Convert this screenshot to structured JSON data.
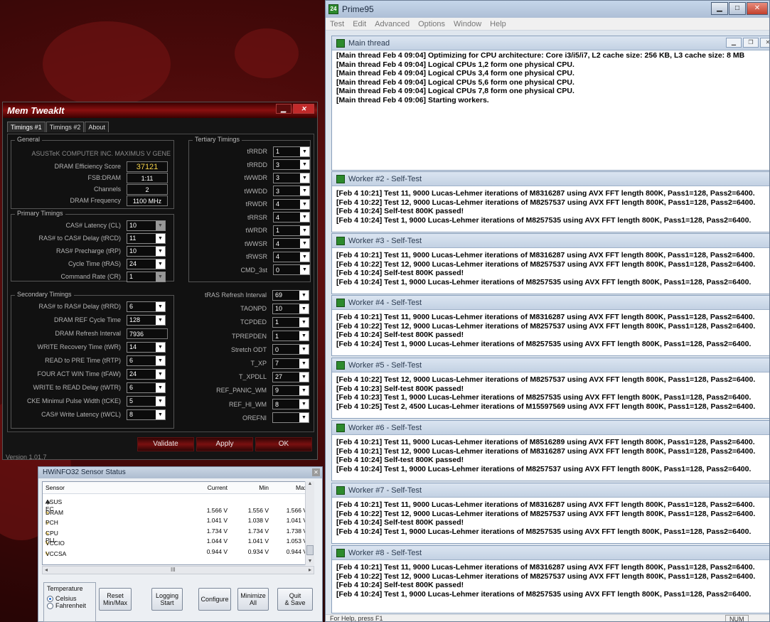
{
  "prime95": {
    "title": "Prime95",
    "menu": [
      "Test",
      "Edit",
      "Advanced",
      "Options",
      "Window",
      "Help"
    ],
    "main_thread": {
      "title": "Main thread",
      "lines": [
        "[Main thread Feb 4 09:04] Optimizing for CPU architecture: Core i3/i5/i7, L2 cache size: 256 KB, L3 cache size: 8 MB",
        "[Main thread Feb 4 09:04] Logical CPUs 1,2 form one physical CPU.",
        "[Main thread Feb 4 09:04] Logical CPUs 3,4 form one physical CPU.",
        "[Main thread Feb 4 09:04] Logical CPUs 5,6 form one physical CPU.",
        "[Main thread Feb 4 09:04] Logical CPUs 7,8 form one physical CPU.",
        "[Main thread Feb 4 09:06] Starting workers."
      ]
    },
    "workers": [
      {
        "title": "Worker #2 - Self-Test",
        "lines": [
          "[Feb 4 10:21] Test 11, 9000 Lucas-Lehmer iterations of M8316287 using AVX FFT length 800K, Pass1=128, Pass2=6400.",
          "[Feb 4 10:22] Test 12, 9000 Lucas-Lehmer iterations of M8257537 using AVX FFT length 800K, Pass1=128, Pass2=6400.",
          "[Feb 4 10:24] Self-test 800K passed!",
          "[Feb 4 10:24] Test 1, 9000 Lucas-Lehmer iterations of M8257535 using AVX FFT length 800K, Pass1=128, Pass2=6400."
        ]
      },
      {
        "title": "Worker #3 - Self-Test",
        "lines": [
          "[Feb 4 10:21] Test 11, 9000 Lucas-Lehmer iterations of M8316287 using AVX FFT length 800K, Pass1=128, Pass2=6400.",
          "[Feb 4 10:22] Test 12, 9000 Lucas-Lehmer iterations of M8257537 using AVX FFT length 800K, Pass1=128, Pass2=6400.",
          "[Feb 4 10:24] Self-test 800K passed!",
          "[Feb 4 10:24] Test 1, 9000 Lucas-Lehmer iterations of M8257535 using AVX FFT length 800K, Pass1=128, Pass2=6400."
        ]
      },
      {
        "title": "Worker #4 - Self-Test",
        "lines": [
          "[Feb 4 10:21] Test 11, 9000 Lucas-Lehmer iterations of M8316287 using AVX FFT length 800K, Pass1=128, Pass2=6400.",
          "[Feb 4 10:22] Test 12, 9000 Lucas-Lehmer iterations of M8257537 using AVX FFT length 800K, Pass1=128, Pass2=6400.",
          "[Feb 4 10:24] Self-test 800K passed!",
          "[Feb 4 10:24] Test 1, 9000 Lucas-Lehmer iterations of M8257535 using AVX FFT length 800K, Pass1=128, Pass2=6400."
        ]
      },
      {
        "title": "Worker #5 - Self-Test",
        "lines": [
          "[Feb 4 10:22] Test 12, 9000 Lucas-Lehmer iterations of M8257537 using AVX FFT length 800K, Pass1=128, Pass2=6400.",
          "[Feb 4 10:23] Self-test 800K passed!",
          "[Feb 4 10:23] Test 1, 9000 Lucas-Lehmer iterations of M8257535 using AVX FFT length 800K, Pass1=128, Pass2=6400.",
          "[Feb 4 10:25] Test 2, 4500 Lucas-Lehmer iterations of M15597569 using AVX FFT length 800K, Pass1=128, Pass2=6400."
        ]
      },
      {
        "title": "Worker #6 - Self-Test",
        "lines": [
          "[Feb 4 10:21] Test 11, 9000 Lucas-Lehmer iterations of M8516289 using AVX FFT length 800K, Pass1=128, Pass2=6400.",
          "[Feb 4 10:21] Test 12, 9000 Lucas-Lehmer iterations of M8316287 using AVX FFT length 800K, Pass1=128, Pass2=6400.",
          "[Feb 4 10:24] Self-test 800K passed!",
          "[Feb 4 10:24] Test 1, 9000 Lucas-Lehmer iterations of M8257537 using AVX FFT length 800K, Pass1=128, Pass2=6400."
        ]
      },
      {
        "title": "Worker #7 - Self-Test",
        "lines": [
          "[Feb 4 10:21] Test 11, 9000 Lucas-Lehmer iterations of M8316287 using AVX FFT length 800K, Pass1=128, Pass2=6400.",
          "[Feb 4 10:22] Test 12, 9000 Lucas-Lehmer iterations of M8257537 using AVX FFT length 800K, Pass1=128, Pass2=6400.",
          "[Feb 4 10:24] Self-test 800K passed!",
          "[Feb 4 10:24] Test 1, 9000 Lucas-Lehmer iterations of M8257535 using AVX FFT length 800K, Pass1=128, Pass2=6400."
        ]
      },
      {
        "title": "Worker #8 - Self-Test",
        "lines": [
          "[Feb 4 10:21] Test 11, 9000 Lucas-Lehmer iterations of M8316287 using AVX FFT length 800K, Pass1=128, Pass2=6400.",
          "[Feb 4 10:22] Test 12, 9000 Lucas-Lehmer iterations of M8257537 using AVX FFT length 800K, Pass1=128, Pass2=6400.",
          "[Feb 4 10:24] Self-test 800K passed!",
          "[Feb 4 10:24] Test 1, 9000 Lucas-Lehmer iterations of M8257535 using AVX FFT length 800K, Pass1=128, Pass2=6400."
        ]
      }
    ],
    "status": "For Help, press F1",
    "status_num": "NUM"
  },
  "memtweak": {
    "title": "Mem TweakIt",
    "tabs": [
      "Timings #1",
      "Timings #2",
      "About"
    ],
    "general": {
      "title": "General",
      "board": "ASUSTeK COMPUTER INC. MAXIMUS V GENE",
      "efficiency_label": "DRAM Efficiency Score",
      "efficiency": "37121",
      "fsb_label": "FSB:DRAM",
      "fsb": "1:11",
      "channels_label": "Channels",
      "channels": "2",
      "freq_label": "DRAM Frequency",
      "freq": "1100 MHz"
    },
    "primary": {
      "title": "Primary Timings",
      "items": [
        {
          "label": "CAS# Latency (CL)",
          "value": "10",
          "disabled": true
        },
        {
          "label": "RAS# to CAS# Delay (tRCD)",
          "value": "11"
        },
        {
          "label": "RAS# Precharge (tRP)",
          "value": "10"
        },
        {
          "label": "Cycle Time (tRAS)",
          "value": "24"
        },
        {
          "label": "Command Rate (CR)",
          "value": "1",
          "disabled": true
        }
      ]
    },
    "secondary": {
      "title": "Secondary Timings",
      "items": [
        {
          "label": "RAS# to RAS# Delay (tRRD)",
          "value": "6"
        },
        {
          "label": "DRAM REF Cycle Time",
          "value": "128"
        },
        {
          "label": "DRAM Refresh Interval",
          "value": "7936",
          "box": true
        },
        {
          "label": "WRITE Recovery Time (tWR)",
          "value": "14"
        },
        {
          "label": "READ to PRE Time (tRTP)",
          "value": "6"
        },
        {
          "label": "FOUR ACT WIN Time (tFAW)",
          "value": "24"
        },
        {
          "label": "WRITE to READ Delay (tWTR)",
          "value": "6"
        },
        {
          "label": "CKE Minimul Pulse Width (tCKE)",
          "value": "5"
        },
        {
          "label": "CAS# Write Latency (tWCL)",
          "value": "8"
        }
      ]
    },
    "tertiary": {
      "title": "Tertiary Timings",
      "items": [
        {
          "label": "tRRDR",
          "value": "1"
        },
        {
          "label": "tRRDD",
          "value": "3"
        },
        {
          "label": "tWWDR",
          "value": "3"
        },
        {
          "label": "tWWDD",
          "value": "3"
        },
        {
          "label": "tRWDR",
          "value": "4"
        },
        {
          "label": "tRRSR",
          "value": "4"
        },
        {
          "label": "tWRDR",
          "value": "1"
        },
        {
          "label": "tWWSR",
          "value": "4"
        },
        {
          "label": "tRWSR",
          "value": "4"
        },
        {
          "label": "CMD_3st",
          "value": "0"
        }
      ]
    },
    "right": [
      {
        "label": "tRAS Refresh Interval",
        "value": "69"
      },
      {
        "label": "TAONPD",
        "value": "10"
      },
      {
        "label": "TCPDED",
        "value": "1"
      },
      {
        "label": "TPREPDEN",
        "value": "1"
      },
      {
        "label": "Stretch ODT",
        "value": "0"
      },
      {
        "label": "T_XP",
        "value": "7"
      },
      {
        "label": "T_XPDLL",
        "value": "27"
      },
      {
        "label": "REF_PANIC_WM",
        "value": "9"
      },
      {
        "label": "REF_HI_WM",
        "value": "8"
      },
      {
        "label": "OREFNI",
        "value": ""
      }
    ],
    "buttons": {
      "validate": "Validate",
      "apply": "Apply",
      "ok": "OK"
    },
    "version": "Version 1.01.7"
  },
  "hwinfo": {
    "title": "HWiNFO32 Sensor Status",
    "columns": {
      "sensor": "Sensor",
      "current": "Current",
      "min": "Min",
      "max": "Max"
    },
    "group": "ASUS EC",
    "rows": [
      {
        "name": "DRAM",
        "current": "1.566 V",
        "min": "1.556 V",
        "max": "1.566 V"
      },
      {
        "name": "PCH",
        "current": "1.041 V",
        "min": "1.038 V",
        "max": "1.041 V"
      },
      {
        "name": "CPU PLL",
        "current": "1.734 V",
        "min": "1.734 V",
        "max": "1.738 V"
      },
      {
        "name": "VCCIO",
        "current": "1.044 V",
        "min": "1.041 V",
        "max": "1.053 V"
      },
      {
        "name": "VCCSA",
        "current": "0.944 V",
        "min": "0.934 V",
        "max": "0.944 V"
      }
    ],
    "scroll_grip": "III",
    "temperature": {
      "title": "Temperature",
      "celsius": "Celsius",
      "fahrenheit": "Fahrenheit"
    },
    "buttons": {
      "reset": "Reset\nMin/Max",
      "logging": "Logging\nStart",
      "configure": "Configure",
      "minimize": "Minimize\nAll",
      "quit": "Quit\n& Save"
    }
  }
}
